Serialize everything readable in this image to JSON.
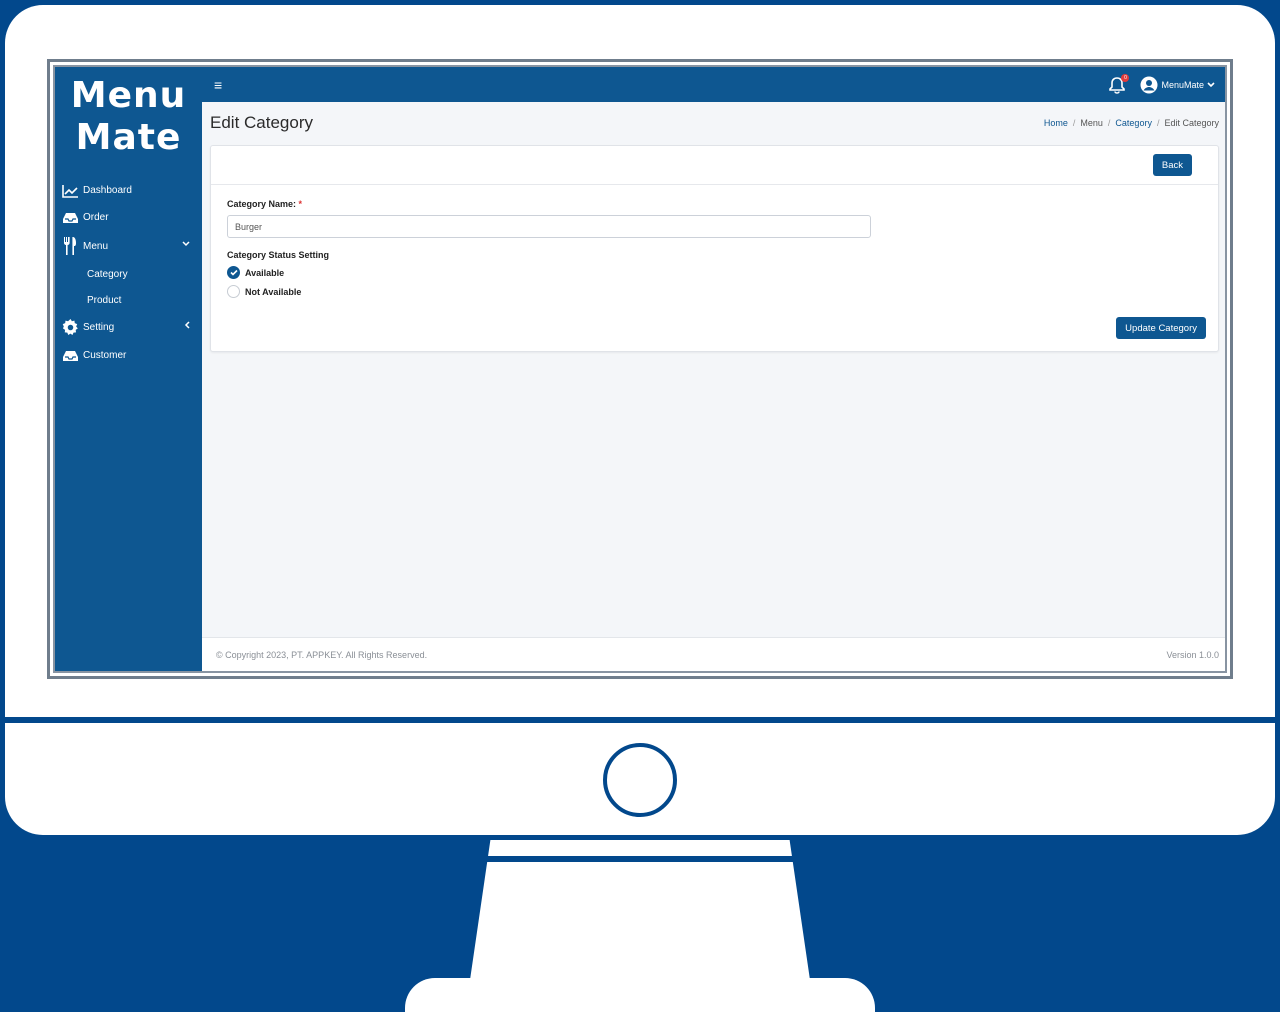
{
  "brand": {
    "line1": "Menu",
    "line2": "Mate"
  },
  "sidebar": {
    "items": [
      {
        "label": "Dashboard",
        "icon": "chart-line-icon"
      },
      {
        "label": "Order",
        "icon": "tray-icon"
      },
      {
        "label": "Menu",
        "icon": "fork-knife-icon"
      },
      {
        "label": "Setting",
        "icon": "gear-icon"
      },
      {
        "label": "Customer",
        "icon": "tray-icon"
      }
    ],
    "menu_sub": [
      {
        "label": "Category"
      },
      {
        "label": "Product"
      }
    ]
  },
  "topbar": {
    "notification_count": "0",
    "username": "MenuMate"
  },
  "page": {
    "title": "Edit Category",
    "breadcrumb": [
      "Home",
      "Menu",
      "Category",
      "Edit Category"
    ]
  },
  "form": {
    "back_label": "Back",
    "name_label": "Category Name:",
    "required_mark": "*",
    "name_value": "Burger",
    "status_label": "Category Status Setting",
    "options": [
      {
        "label": "Available",
        "checked": true
      },
      {
        "label": "Not Available",
        "checked": false
      }
    ],
    "submit_label": "Update Category"
  },
  "footer": {
    "copyright": "© Copyright 2023, PT. APPKEY. All Rights Reserved.",
    "version": "Version 1.0.0"
  },
  "colors": {
    "primary": "#0e5791",
    "frame": "#02488c",
    "badge": "#e23b3b"
  }
}
